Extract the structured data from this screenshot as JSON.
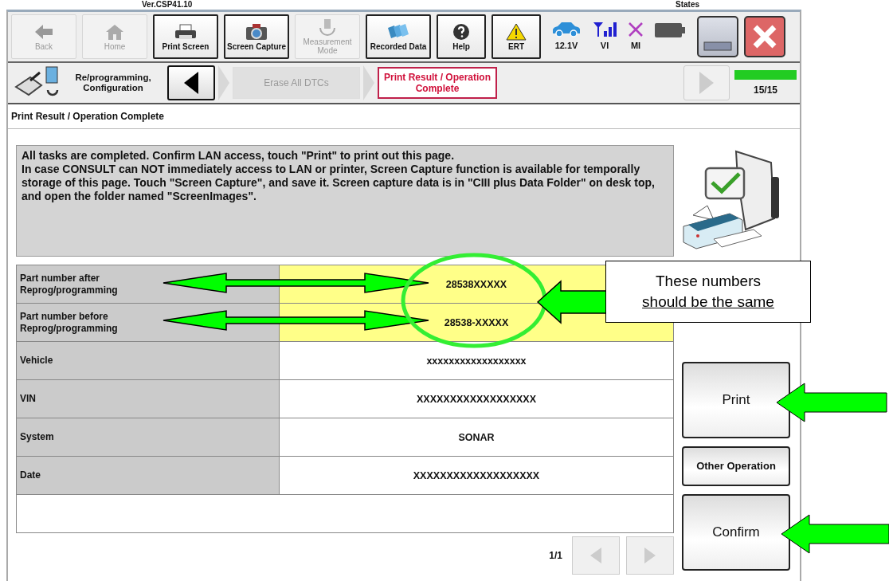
{
  "header": {
    "version": "Ver.CSP41.10",
    "states_label": "States"
  },
  "toolbar": [
    {
      "label": "Back",
      "disabled": true
    },
    {
      "label": "Home",
      "disabled": true
    },
    {
      "label": "Print Screen",
      "disabled": false
    },
    {
      "label": "Screen Capture",
      "disabled": false
    },
    {
      "label": "Measurement Mode",
      "disabled": true
    },
    {
      "label": "Recorded Data",
      "disabled": false
    },
    {
      "label": "Help",
      "disabled": false
    },
    {
      "label": "ERT",
      "disabled": false
    }
  ],
  "indicators": [
    {
      "label": "12.1V"
    },
    {
      "label": "VI"
    },
    {
      "label": "MI"
    }
  ],
  "nav": {
    "section": "Re/programming, Configuration",
    "steps": [
      {
        "label": "Erase All DTCs",
        "selected": false
      },
      {
        "label": "Print Result / Operation Complete",
        "selected": true
      }
    ],
    "progress": {
      "level": 1,
      "reading": "15/15"
    }
  },
  "page_title": "Print Result / Operation Complete",
  "message": "All tasks are completed. Confirm LAN access, touch \"Print\" to print out this page.\nIn case CONSULT can NOT immediately access to LAN or printer, Screen Capture function is available for temporally storage of this page. Touch \"Screen Capture\", and save it. Screen capture data is in \"CIII plus Data Folder\" on desk top, and open the folder named \"ScreenImages\".",
  "table": {
    "rows": [
      {
        "label": "Part number after Reprog/programming",
        "value": "28538XXXXX",
        "highlighted": true
      },
      {
        "label": "Part number before Reprog/programming",
        "value": "28538-XXXXX",
        "highlighted": true
      },
      {
        "label": "Vehicle",
        "value": "xxxxxxxxxxxxxxxxxx",
        "highlighted": false
      },
      {
        "label": "VIN",
        "value": "XXXXXXXXXXXXXXXXXX",
        "highlighted": false
      },
      {
        "label": "System",
        "value": "SONAR",
        "highlighted": false
      },
      {
        "label": "Date",
        "value": "XXXXXXXXXXXXXXXXXXX",
        "highlighted": false
      }
    ]
  },
  "pager": {
    "reading": "1/1"
  },
  "side_buttons": [
    {
      "label": "Print",
      "kind": "large"
    },
    {
      "label": "Other Operation",
      "kind": "small"
    },
    {
      "label": "Confirm",
      "kind": "large"
    }
  ],
  "callout": {
    "lines": [
      {
        "text": "These numbers",
        "underlined": false
      },
      {
        "text": "should be the same",
        "underlined": true
      }
    ]
  }
}
